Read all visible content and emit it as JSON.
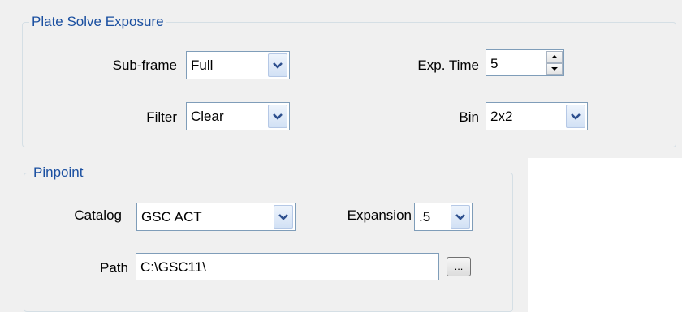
{
  "plate_solve": {
    "title": "Plate Solve Exposure",
    "subframe": {
      "label": "Sub-frame",
      "value": "Full"
    },
    "filter": {
      "label": "Filter",
      "value": "Clear"
    },
    "exp_time": {
      "label": "Exp. Time",
      "value": "5"
    },
    "bin": {
      "label": "Bin",
      "value": "2x2"
    }
  },
  "pinpoint": {
    "title": "Pinpoint",
    "catalog": {
      "label": "Catalog",
      "value": "GSC ACT"
    },
    "expansion": {
      "label": "Expansion",
      "value": ".5"
    },
    "path": {
      "label": "Path",
      "value": "C:\\GSC11\\"
    },
    "browse_label": "..."
  },
  "icons": {
    "dropdown": "chevron-down-icon",
    "spin_up": "triangle-up-icon",
    "spin_down": "triangle-down-icon"
  },
  "colors": {
    "group_title": "#1a4fa0",
    "panel_background": "#f0f0f0",
    "control_border": "#7f9db9"
  }
}
